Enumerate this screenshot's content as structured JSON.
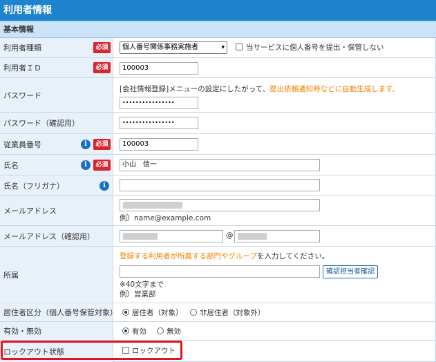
{
  "title": "利用者情報",
  "section": "基本情報",
  "required_label": "必須",
  "info_glyph": "i",
  "rows": {
    "user_type": {
      "label": "利用者種類",
      "select_value": "個人番号関係事務実施者",
      "checkbox_label": "当サービスに個人番号を提出・保管しない"
    },
    "user_id": {
      "label": "利用者ＩＤ",
      "value": "100003"
    },
    "password": {
      "label": "パスワード",
      "note_prefix": "[会社情報登録]メニューの設定にしたがって、",
      "note_highlight": "提出依頼通知時などに自動生成します。",
      "value": "••••••••••••••••"
    },
    "password_confirm": {
      "label": "パスワード（確認用）",
      "value": "••••••••••••••••"
    },
    "employee_no": {
      "label": "従業員番号",
      "value": "100003"
    },
    "name": {
      "label": "氏名",
      "value": "小山　信一"
    },
    "name_kana": {
      "label": "氏名（フリガナ）",
      "value": ""
    },
    "email": {
      "label": "メールアドレス",
      "example": "例）name@example.com"
    },
    "email_confirm": {
      "label": "メールアドレス（確認用）",
      "at": "@"
    },
    "department": {
      "label": "所属",
      "note_highlight": "登録する利用者が所属する部門やグループ",
      "note_suffix": "を入力してください。",
      "button": "確認担当者確認",
      "limit": "※40文字まで",
      "example": "例）営業部"
    },
    "residency": {
      "label": "居住者区分（個人番号保管対象）",
      "option1": "居住者（対象）",
      "option2": "非居住者（対象外）",
      "selected": "居住者（対象）"
    },
    "status": {
      "label": "有効・無効",
      "option1": "有効",
      "option2": "無効",
      "selected": "有効"
    },
    "lockout": {
      "label": "ロックアウト状態",
      "checkbox_label": "ロックアウト",
      "checked": false
    }
  },
  "colors": {
    "title_bg": "#1c83cc",
    "section_bg": "#cbe3f7",
    "label_bg": "#e8f1fa",
    "required_bg": "#d9252e",
    "info_icon": "#1a6fc4",
    "orange_note": "#f08300",
    "highlight_border": "#e0141e"
  }
}
